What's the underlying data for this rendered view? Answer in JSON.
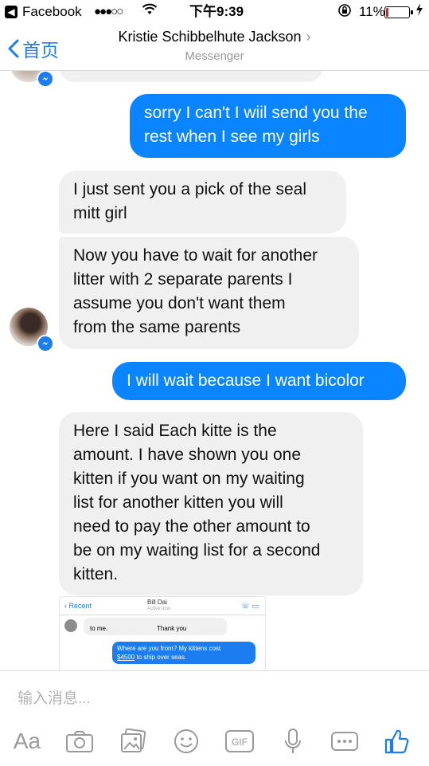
{
  "status_bar": {
    "back_app": "Facebook",
    "signal": "●●●○○",
    "time": "下午9:39",
    "battery_pct": "11%",
    "battery_level": 0.11,
    "battery_color": "#e0201c"
  },
  "nav": {
    "back_label": "首页",
    "contact_name": "Kristie Schibbelhute Jackson",
    "chevron": "›",
    "subtitle": "Messenger"
  },
  "messages": [
    {
      "dir": "in",
      "text": ""
    },
    {
      "dir": "out",
      "text": "sorry I can't I wiil send you the\nrest when I see my girls"
    },
    {
      "dir": "in",
      "text": "I just sent you a pick of the seal\nmitt girl"
    },
    {
      "dir": "in",
      "text": "Now you have to wait for another\nlitter with 2 separate parents I\nassume you don't want them\nfrom the same parents"
    },
    {
      "dir": "out",
      "text": "I will wait because I want bicolor"
    },
    {
      "dir": "in",
      "text": "Here I said Each kitte is the\namount. I have shown you one\nkitten if you want on my waiting\nlist for another kitten you will\nneed to pay the other amount to\nbe on my waiting list for a second\nkitten."
    }
  ],
  "embedded_screenshot": {
    "back": "Recent",
    "name": "Bill Dai",
    "status": "Active now",
    "msg_in_left": "to me.",
    "msg_in_right": "Thank you",
    "msg_out_line1": "Where are you from? My kittens cost",
    "msg_out_price": "$4500",
    "msg_out_line2_rest": "to ship over seas."
  },
  "composer": {
    "placeholder": "输入消息...",
    "aa_label": "Aa",
    "accent_color": "#1b7df0"
  },
  "colors": {
    "outgoing_bubble": "#0a84ff",
    "incoming_bubble": "#f1f0f0",
    "link_blue": "#1b7df0"
  }
}
